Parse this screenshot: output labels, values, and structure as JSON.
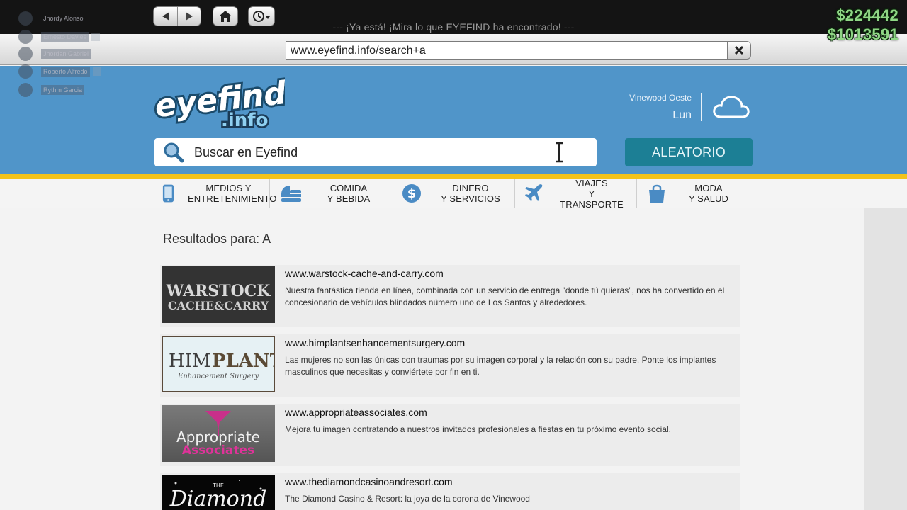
{
  "window": {
    "title": "--- ¡Ya está! ¡Mira lo que EYEFIND ha encontrado! ---"
  },
  "money": {
    "wallet": "$224442",
    "bank": "$1013591",
    "color": "#8fd685"
  },
  "players": [
    {
      "name": "Jhordy Alonso"
    },
    {
      "name": "Ernesto Davies"
    },
    {
      "name": "Jhordan Gabriel"
    },
    {
      "name": "Roberto Alfredo"
    },
    {
      "name": "Rythm Garcia"
    }
  ],
  "browser": {
    "url": "www.eyefind.info/search+a"
  },
  "brand": {
    "logo_text": "eyefind",
    "logo_suffix": ".info",
    "header_color": "#5095c9",
    "accent_color": "#f2c31b"
  },
  "location": {
    "city": "Vinewood Oeste",
    "day": "Lun",
    "weather_icon": "cloud-icon"
  },
  "search": {
    "placeholder": "Buscar en Eyefind"
  },
  "random_button": {
    "label": "ALEATORIO",
    "color": "#1c7f95"
  },
  "categories": [
    {
      "line1": "MEDIOS Y",
      "line2": "ENTRETENIMIENTO",
      "icon": "phone-icon"
    },
    {
      "line1": "COMIDA",
      "line2": "Y BEBIDA",
      "icon": "food-icon"
    },
    {
      "line1": "DINERO",
      "line2": "Y SERVICIOS",
      "icon": "dollar-icon"
    },
    {
      "line1": "VIAJES",
      "line2": "Y TRANSPORTE",
      "icon": "airplane-icon"
    },
    {
      "line1": "MODA",
      "line2": "Y SALUD",
      "icon": "shopping-bag-icon"
    }
  ],
  "results_title": "Resultados para: A",
  "results": [
    {
      "url": "www.warstock-cache-and-carry.com",
      "desc": "Nuestra fantástica tienda en línea, combinada con un servicio de entrega \"donde tú quieras\", nos ha convertido en el concesionario de vehículos blindados número uno de Los Santos y alrededores.",
      "thumb": {
        "line1": "WARSTOCK",
        "line2": "CACHE&CARRY"
      }
    },
    {
      "url": "www.himplantsenhancementsurgery.com",
      "desc": "Las mujeres no son las únicas con traumas por su imagen corporal y la relación con su padre. Ponte los implantes masculinos que necesitas y conviértete por fin en ti.",
      "thumb": {
        "line1a": "HIM",
        "line1b": "PLANTS",
        "line2": "Enhancement Surgery"
      }
    },
    {
      "url": "www.appropriateassociates.com",
      "desc": "Mejora tu imagen contratando a nuestros invitados profesionales a fiestas en tu próximo evento social.",
      "thumb": {
        "line1": "Appropriate",
        "line2": "Associates"
      }
    },
    {
      "url": "www.thediamondcasinoandresort.com",
      "desc": "The Diamond Casino & Resort: la joya de la corona de Vinewood",
      "thumb": {
        "line1": "THE",
        "line2": "Diamond"
      }
    }
  ]
}
